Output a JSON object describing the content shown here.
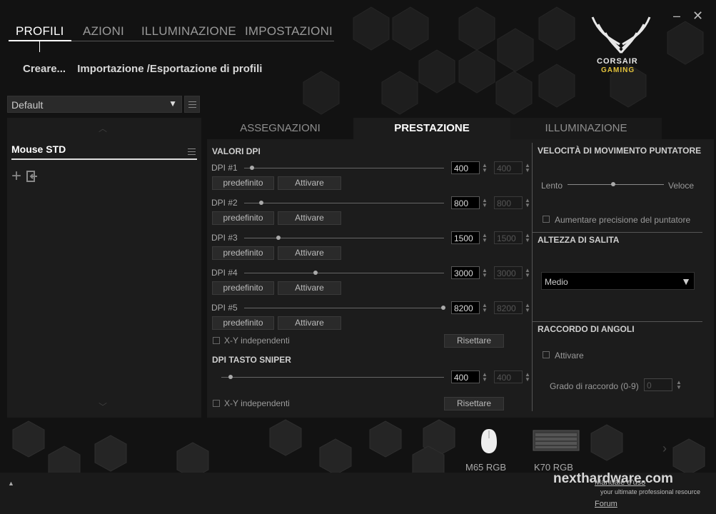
{
  "nav": {
    "tabs": [
      {
        "label": "PROFILI",
        "active": true
      },
      {
        "label": "AZIONI",
        "active": false
      },
      {
        "label": "ILLUMINAZIONE",
        "active": false
      },
      {
        "label": "IMPOSTAZIONI",
        "active": false
      }
    ],
    "create": "Creare...",
    "import_export": "Importazione /Esportazione di profili"
  },
  "window": {
    "minimize": "–",
    "close": "✕"
  },
  "logo": {
    "line1": "CORSAIR",
    "line2": "GAMING"
  },
  "profile": {
    "selected": "Default"
  },
  "left": {
    "item": "Mouse STD"
  },
  "main_tabs": [
    {
      "label": "ASSEGNAZIONI",
      "active": false
    },
    {
      "label": "PRESTAZIONE",
      "active": true
    },
    {
      "label": "ILLUMINAZIONE",
      "active": false
    }
  ],
  "dpi": {
    "title": "VALORI DPI",
    "levels": [
      {
        "label": "DPI #1",
        "x": "400",
        "y": "400",
        "slider": 0.02
      },
      {
        "label": "DPI #2",
        "x": "800",
        "y": "800",
        "slider": 0.08
      },
      {
        "label": "DPI #3",
        "x": "1500",
        "y": "1500",
        "slider": 0.17
      },
      {
        "label": "DPI #4",
        "x": "3000",
        "y": "3000",
        "slider": 0.36
      },
      {
        "label": "DPI #5",
        "x": "8200",
        "y": "8200",
        "slider": 0.99
      }
    ],
    "default_btn": "predefinito",
    "activate_btn": "Attivare",
    "xy": "X-Y independenti",
    "reset": "Risettare"
  },
  "sniper": {
    "title": "DPI TASTO SNIPER",
    "x": "400",
    "y": "400",
    "xy": "X-Y independenti",
    "reset": "Risettare"
  },
  "pointer": {
    "title": "VELOCITÀ DI MOVIMENTO PUNTATORE",
    "slow": "Lento",
    "fast": "Veloce",
    "precision": "Aumentare precisione del puntatore"
  },
  "lift": {
    "title": "ALTEZZA DI SALITA",
    "value": "Medio"
  },
  "angle": {
    "title": "RACCORDO DI ANGOLI",
    "activate": "Attivare",
    "degree_label": "Grado di raccordo (0-9)",
    "degree": "0"
  },
  "devices": [
    {
      "label": "M65 RGB"
    },
    {
      "label": "K70 RGB"
    }
  ],
  "footer": {
    "watermark": "nexthardware.com",
    "tagline": "your ultimate professional resource",
    "manuale": "Manuale d'uso",
    "forum": "Forum"
  }
}
